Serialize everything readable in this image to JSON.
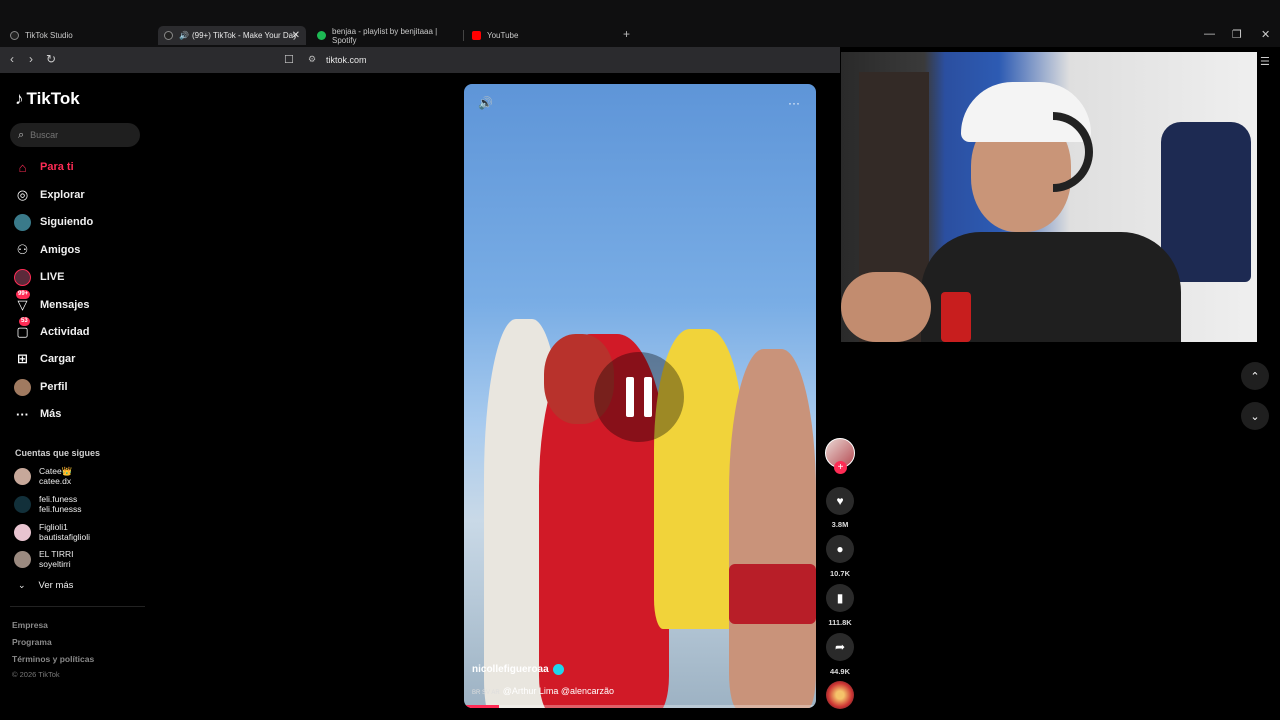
{
  "browser": {
    "tabs": [
      {
        "label": "TikTok Studio",
        "active": false
      },
      {
        "label": "(99+) TikTok - Make Your Day",
        "active": true
      },
      {
        "label": "benjaa - playlist by benjitaaa | Spotify",
        "active": false
      },
      {
        "label": "YouTube",
        "active": false
      }
    ],
    "url": "tiktok.com"
  },
  "sidebar": {
    "logo": "TikTok",
    "search_placeholder": "Buscar",
    "nav": [
      {
        "label": "Para ti",
        "icon": "home-icon"
      },
      {
        "label": "Explorar",
        "icon": "compass-icon"
      },
      {
        "label": "Siguiendo",
        "icon": "following-icon"
      },
      {
        "label": "Amigos",
        "icon": "friends-icon"
      },
      {
        "label": "LIVE",
        "icon": "live-icon"
      },
      {
        "label": "Mensajes",
        "icon": "messages-icon",
        "badge": "99+"
      },
      {
        "label": "Actividad",
        "icon": "activity-icon",
        "badge": "53"
      },
      {
        "label": "Cargar",
        "icon": "upload-icon"
      },
      {
        "label": "Perfil",
        "icon": "profile-icon"
      },
      {
        "label": "Más",
        "icon": "more-icon"
      }
    ],
    "following_title": "Cuentas que sigues",
    "following": [
      {
        "name": "Catee👑",
        "handle": "catee.dx"
      },
      {
        "name": "feli.funess",
        "handle": "feli.funesss"
      },
      {
        "name": "Figlioli1",
        "handle": "bautistafiglioli"
      },
      {
        "name": "EL TIRRI",
        "handle": "soyeltirri"
      }
    ],
    "see_more": "Ver más",
    "footer": {
      "company": "Empresa",
      "program": "Programa",
      "terms": "Términos y políticas",
      "copyright": "© 2026 TikTok"
    }
  },
  "video": {
    "author": "nicollefigueroaa",
    "caption_flags": "BR SV AR",
    "caption": "@Arthur Lima @alencarzão",
    "progress": 0.1
  },
  "actions": {
    "likes": "3.8M",
    "comments": "10.7K",
    "saves": "111.8K",
    "shares": "44.9K"
  }
}
